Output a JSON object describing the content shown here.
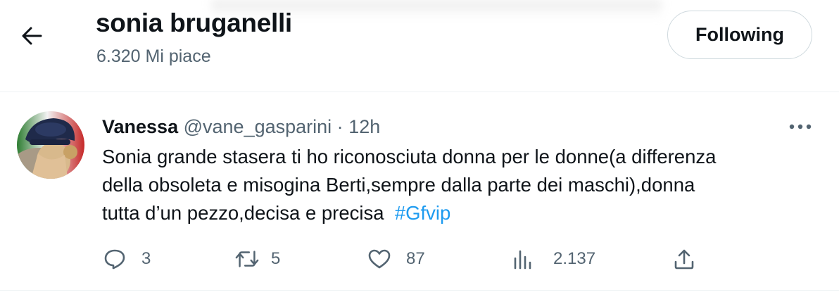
{
  "header": {
    "title": "sonia bruganelli",
    "subtitle": "6.320 Mi piace",
    "follow_button_label": "Following"
  },
  "tweet": {
    "author_name": "Vanessa",
    "author_handle": "@vane_gasparini",
    "separator": "·",
    "time": "12h",
    "text_line_1": "Sonia grande stasera ti ho riconosciuta donna per le donne(a differenza",
    "text_line_2": "della obsoleta e misogina Berti,sempre dalla parte dei maschi),donna",
    "text_line_3": "tutta d’un pezzo,decisa e precisa",
    "hashtag": "#Gfvip",
    "actions": {
      "replies": "3",
      "retweets": "5",
      "likes": "87",
      "views": "2.137"
    }
  },
  "icons": {
    "back": "arrow-left-icon",
    "more": "more-dots-icon",
    "reply": "reply-bubble-icon",
    "retweet": "retweet-icon",
    "like": "heart-icon",
    "views": "analytics-bars-icon",
    "share": "share-icon"
  },
  "colors": {
    "text_primary": "#0f1419",
    "text_secondary": "#536471",
    "link": "#1d9bf0",
    "border": "#cfd9de"
  }
}
